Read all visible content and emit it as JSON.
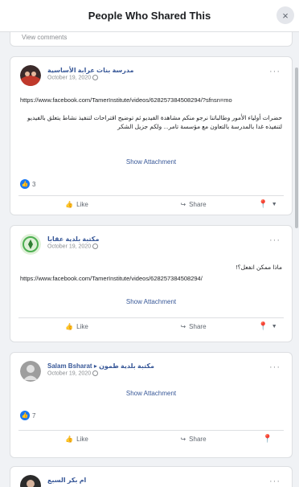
{
  "dialog": {
    "title": "People Who Shared This",
    "close_glyph": "×"
  },
  "top": {
    "view_comments": "View comments"
  },
  "posts": [
    {
      "author": "مدرسة بنات عرابة الأساسية",
      "date": "October 19, 2020",
      "url": "https://www.facebook.com/TamerInstitute/videos/628257384508294/?sfnsn=mo",
      "body_ar": "حضرات أولياء الأمور وطالباتنا نرجو منكم مشاهدة الفيديو ثم توضيح اقتراحات لتنفيذ نشاط يتعلق بالفيديو لتنفيذه غدا بالمدرسة بالتعاون مع مؤسسة تامر... ولكم جزيل الشكر",
      "show_attachment": "Show Attachment",
      "reactions": "3",
      "like": "Like",
      "share": "Share"
    },
    {
      "author": "مكتبة بلدية عقابا",
      "date": "October 19, 2020",
      "body_ar": "ماذا ممكن انفعل؟!",
      "url": "https://www.facebook.com/TamerInstitute/videos/628257384508294/",
      "show_attachment": "Show Attachment",
      "like": "Like",
      "share": "Share"
    },
    {
      "author_en": "Salam Bsharat",
      "author_ar": "مكتبة بلدية طمون",
      "date": "October 19, 2020",
      "show_attachment": "Show Attachment",
      "reactions": "7",
      "like": "Like",
      "share": "Share"
    },
    {
      "author": "ام بكر السبع"
    }
  ],
  "icons": {
    "like": "thumbs-up-icon",
    "share": "share-arrow-icon",
    "pin": "pin-icon",
    "more": "more-dots-icon",
    "globe": "globe-icon"
  },
  "colors": {
    "link": "#385898",
    "accent": "#1877f2",
    "muted": "#8a8d91"
  }
}
